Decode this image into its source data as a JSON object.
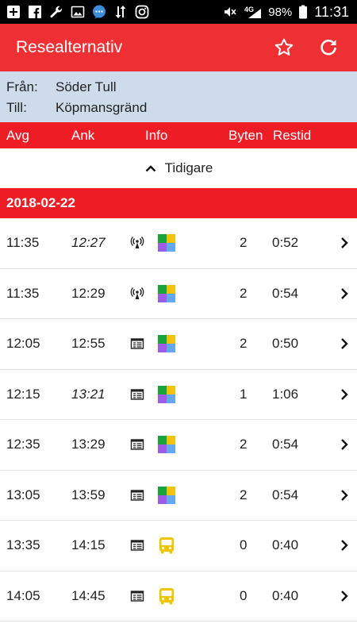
{
  "status_bar": {
    "left_icons": [
      "add-box-icon",
      "facebook-icon",
      "wrench-icon",
      "image-icon",
      "chat-bubble-icon",
      "data-transfer-icon",
      "instagram-icon"
    ],
    "network": "4G",
    "battery": "98%",
    "time": "11:31"
  },
  "app_bar": {
    "title": "Resealternativ",
    "favorite_icon": "star-outline-icon",
    "refresh_icon": "refresh-icon"
  },
  "route": {
    "from_label": "Från:",
    "from_value": "Söder Tull",
    "to_label": "Till:",
    "to_value": "Köpmansgränd"
  },
  "columns": {
    "departure": "Avg",
    "arrival": "Ank",
    "info": "Info",
    "changes": "Byten",
    "duration": "Restid"
  },
  "earlier": {
    "label": "Tidigare"
  },
  "date_header": "2018-02-22",
  "trips": [
    {
      "dep": "11:35",
      "arr": "12:27",
      "arr_realtime": true,
      "info": "realtime",
      "mode": "mixed",
      "changes": "2",
      "duration": "0:52"
    },
    {
      "dep": "11:35",
      "arr": "12:29",
      "arr_realtime": false,
      "info": "realtime",
      "mode": "mixed",
      "changes": "2",
      "duration": "0:54"
    },
    {
      "dep": "12:05",
      "arr": "12:55",
      "arr_realtime": false,
      "info": "timetable",
      "mode": "mixed",
      "changes": "2",
      "duration": "0:50"
    },
    {
      "dep": "12:15",
      "arr": "13:21",
      "arr_realtime": true,
      "info": "timetable",
      "mode": "mixed",
      "changes": "1",
      "duration": "1:06"
    },
    {
      "dep": "12:35",
      "arr": "13:29",
      "arr_realtime": false,
      "info": "timetable",
      "mode": "mixed",
      "changes": "2",
      "duration": "0:54"
    },
    {
      "dep": "13:05",
      "arr": "13:59",
      "arr_realtime": false,
      "info": "timetable",
      "mode": "mixed",
      "changes": "2",
      "duration": "0:54"
    },
    {
      "dep": "13:35",
      "arr": "14:15",
      "arr_realtime": false,
      "info": "timetable",
      "mode": "bus",
      "changes": "0",
      "duration": "0:40"
    },
    {
      "dep": "14:05",
      "arr": "14:45",
      "arr_realtime": false,
      "info": "timetable",
      "mode": "bus",
      "changes": "0",
      "duration": "0:40"
    }
  ],
  "colors": {
    "app_bar": "#ee3034",
    "header_red": "#ee1c25",
    "route_bg": "#cddbea",
    "bus_yellow": "#f5c400"
  }
}
